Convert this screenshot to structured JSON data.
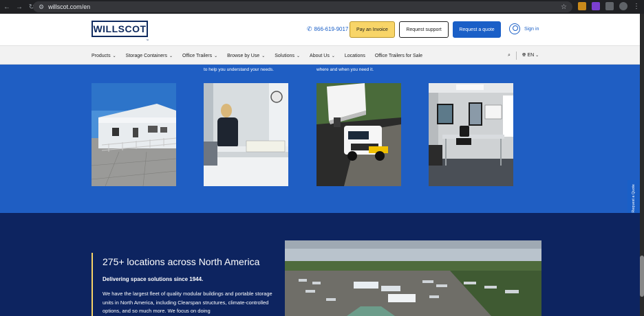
{
  "browser": {
    "url": "willscot.com/en"
  },
  "header": {
    "logo": "WILLSCOT",
    "logo_tm": "™",
    "phone": "866-619-9017",
    "pay_invoice": "Pay an Invoice",
    "request_support": "Request support",
    "request_quote": "Request a quote",
    "sign_in": "Sign in"
  },
  "nav": {
    "items": [
      {
        "label": "Products",
        "dropdown": true
      },
      {
        "label": "Storage Containers",
        "dropdown": true
      },
      {
        "label": "Office Trailers",
        "dropdown": true
      },
      {
        "label": "Browse by Use",
        "dropdown": true
      },
      {
        "label": "Solutions",
        "dropdown": true
      },
      {
        "label": "About Us",
        "dropdown": true
      },
      {
        "label": "Locations",
        "dropdown": false
      },
      {
        "label": "Office Trailers for Sale",
        "dropdown": false
      }
    ],
    "language": "EN"
  },
  "blue_section": {
    "captions": [
      "to help you understand your needs.",
      "where and when you need it."
    ],
    "side_tab": "Request a Quote"
  },
  "locations": {
    "title": "275+ locations across North America",
    "subtitle": "Delivering space solutions since 1944.",
    "paragraph": "We have the largest fleet of quality modular buildings and portable storage units in North America, including Clearspan structures, climate-controlled options, and so much more. We focus on doing"
  },
  "colors": {
    "brand_blue": "#1a5fc7",
    "section_blue": "#1f5ec3",
    "navy": "#0d2460",
    "accent_yellow": "#f8d568"
  }
}
